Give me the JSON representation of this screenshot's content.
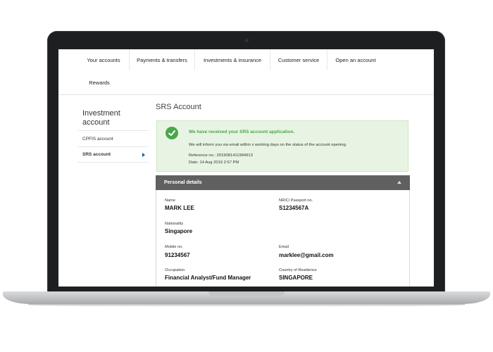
{
  "nav": {
    "items": [
      "Your accounts",
      "Payments & transfers",
      "Investments & insurance",
      "Customer service",
      "Open an account",
      "Rewards"
    ]
  },
  "sidebar": {
    "title": "Investment account",
    "items": [
      {
        "label": "CPFIS account",
        "active": false
      },
      {
        "label": "SRS account",
        "active": true
      }
    ]
  },
  "page": {
    "title": "SRS Account"
  },
  "alert": {
    "heading": "We have received your SRS account application.",
    "message": "We will inform you via email within x working days on the status of the account opening.",
    "reference": "Reference no.: 2019081411994913",
    "date": "Date: 14 Aug 2019 2:57 PM",
    "color": "#4aa64a"
  },
  "personal_details": {
    "header": "Personal details",
    "fields": {
      "name": {
        "label": "Name",
        "value": "MARK LEE"
      },
      "nric": {
        "label": "NRIC/ Passport no.",
        "value": "S1234567A"
      },
      "nationality": {
        "label": "Nationality",
        "value": "Singapore"
      },
      "mobile": {
        "label": "Mobile no.",
        "value": "91234567"
      },
      "email": {
        "label": "Email",
        "value": "marklee@gmail.com"
      },
      "occupation": {
        "label": "Occupation",
        "value": "Financial Analyst/Fund Manager"
      },
      "residence": {
        "label": "Country of Residence",
        "value": "SINGAPORE"
      }
    }
  }
}
